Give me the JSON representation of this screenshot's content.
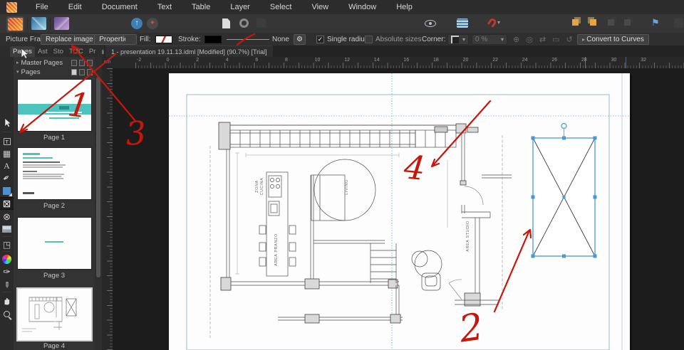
{
  "menu": {
    "items": [
      "File",
      "Edit",
      "Document",
      "Text",
      "Table",
      "Layer",
      "Select",
      "View",
      "Window",
      "Help"
    ]
  },
  "doc_tab": {
    "title": "1 - presentation 19.11.13.idml [Modified] (90.7%) [Trial]"
  },
  "context_toolbar": {
    "tool_label": "Picture Frame",
    "replace_image_label": "Replace image",
    "properties_label": "Properties",
    "fill_label": "Fill:",
    "stroke_label": "Stroke:",
    "stroke_style_value": "None",
    "single_radius_label": "Single radius",
    "absolute_sizes_label": "Absolute sizes",
    "corner_label": "Corner:",
    "corner_value": "0 %",
    "convert_label": "Convert to Curves"
  },
  "pages_panel": {
    "tabs": [
      "Pages",
      "Ast",
      "Sto",
      "TOC",
      "Pr"
    ],
    "master_pages_label": "Master Pages",
    "pages_label": "Pages",
    "pages": [
      {
        "label": "Page 1"
      },
      {
        "label": "Page 2"
      },
      {
        "label": "Page 3"
      },
      {
        "label": "Page 4"
      }
    ]
  },
  "ruler": {
    "unit": "cm",
    "start": -2,
    "end": 32,
    "step": 2
  },
  "plan": {
    "labels": {
      "zona": "ZONA",
      "cucina": "CUCINA",
      "area_pranzo": "AREA PRANZO",
      "living": "LIVING",
      "area_studio": "AREA STUDIO"
    }
  },
  "annotations": {
    "digits": [
      "1",
      "2",
      "3",
      "4"
    ]
  },
  "colors": {
    "accent_teal": "#4cc3bc",
    "selection_blue": "#4a97d6",
    "annotation_red": "#c6170b",
    "app_orange": "#e8432d"
  }
}
